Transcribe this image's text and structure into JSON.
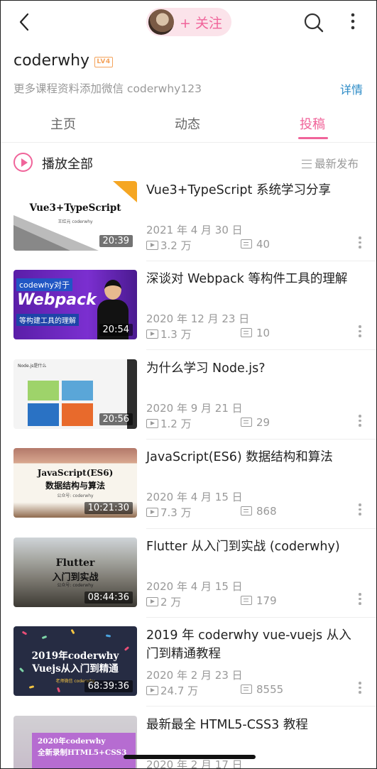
{
  "header": {
    "back_icon": "chevron-left-icon",
    "follow_label": "+ 关注",
    "search_icon": "search-icon",
    "more_icon": "more-vertical-icon",
    "accent_color": "#f0649a"
  },
  "profile": {
    "username": "coderwhy",
    "level": "LV4",
    "bio": "更多课程资料添加微信 coderwhy123",
    "detail_link": "详情"
  },
  "tabs": [
    {
      "label": "主页",
      "active": false
    },
    {
      "label": "动态",
      "active": false
    },
    {
      "label": "投稿",
      "active": true
    }
  ],
  "list_header": {
    "play_all": "播放全部",
    "sort": "最新发布"
  },
  "videos": [
    {
      "title": "Vue3+TypeScript 系统学习分享",
      "date": "2021 年 4 月 30 日",
      "views": "3.2 万",
      "comments": "40",
      "duration": "20:39",
      "thumb_text": [
        "Vue3+TypeScript",
        "王红元 coderwhy"
      ]
    },
    {
      "title": "深谈对 Webpack 等构件工具的理解",
      "date": "2020 年 12 月 23 日",
      "views": "1.3 万",
      "comments": "10",
      "duration": "20:54",
      "thumb_text": [
        "codewhy对于",
        "Webpack",
        "等构建工具的理解"
      ]
    },
    {
      "title": "为什么学习 Node.js?",
      "date": "2020 年 9 月 21 日",
      "views": "1.2 万",
      "comments": "29",
      "duration": "20:56",
      "thumb_text": [
        "Node.js是什么"
      ]
    },
    {
      "title": "JavaScript(ES6) 数据结构和算法",
      "date": "2020 年 4 月 15 日",
      "views": "7.3 万",
      "comments": "868",
      "duration": "10:21:30",
      "thumb_text": [
        "JavaScript(ES6)",
        "数据结构与算法",
        "公众号: coderwhy"
      ]
    },
    {
      "title": "Flutter 从入门到实战 (coderwhy)",
      "date": "2020 年 4 月 15 日",
      "views": "2 万",
      "comments": "179",
      "duration": "08:44:36",
      "thumb_text": [
        "Flutter",
        "入门到实战",
        "公众号: coderwhy"
      ]
    },
    {
      "title": "2019 年 coderwhy vue-vuejs 从入门到精通教程",
      "date": "2020 年 2 月 23 日",
      "views": "24.7 万",
      "comments": "8555",
      "duration": "68:39:36",
      "thumb_text": [
        "2019年coderwhy",
        "Vuejs从入门到精通",
        "老师微信 coderwhy"
      ]
    },
    {
      "title": "最新最全 HTML5-CSS3 教程",
      "date": "2020 年 2 月 17 日",
      "views": "",
      "comments": "",
      "duration": "",
      "thumb_text": [
        "2020年coderwhy",
        "全新录制HTML5+CSS3"
      ]
    }
  ]
}
